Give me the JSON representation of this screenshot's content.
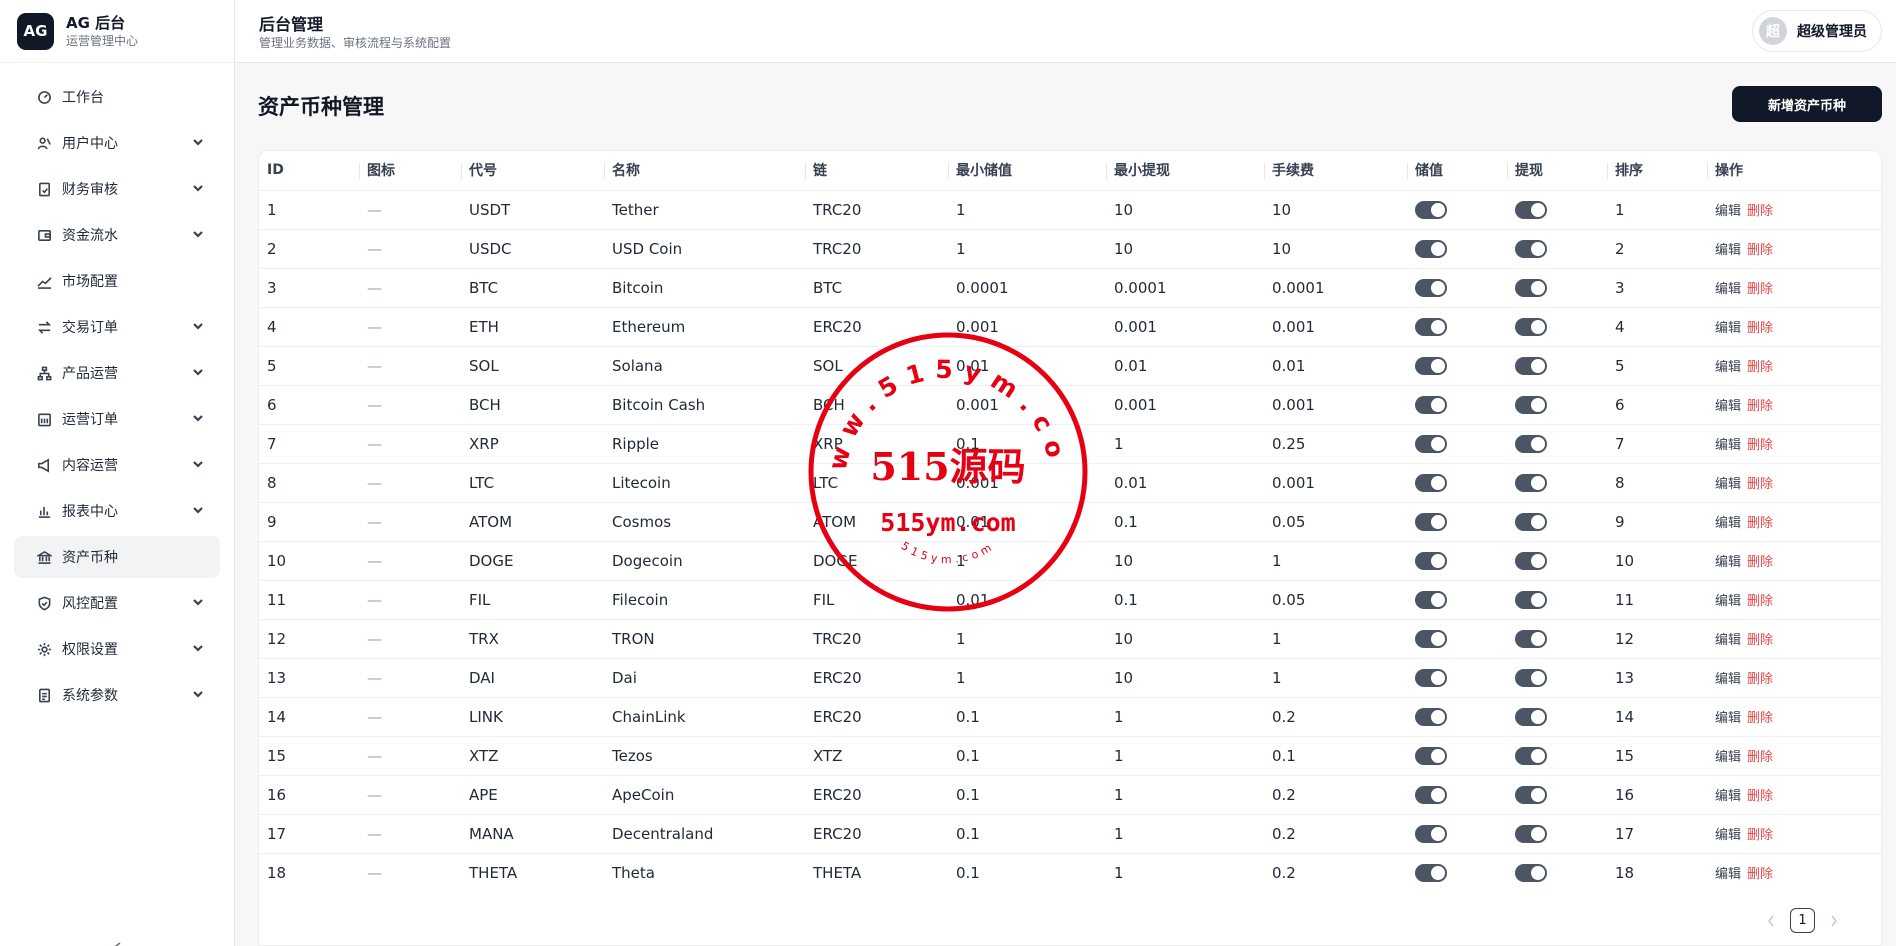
{
  "brand": {
    "logo": "AG",
    "title": "AG 后台",
    "subtitle": "运营管理中心"
  },
  "sidebar": {
    "items": [
      {
        "label": "工作台",
        "icon": "dashboard-icon",
        "expandable": false
      },
      {
        "label": "用户中心",
        "icon": "users-icon",
        "expandable": true
      },
      {
        "label": "财务审核",
        "icon": "file-check-icon",
        "expandable": true
      },
      {
        "label": "资金流水",
        "icon": "wallet-icon",
        "expandable": true
      },
      {
        "label": "市场配置",
        "icon": "trend-icon",
        "expandable": false
      },
      {
        "label": "交易订单",
        "icon": "swap-icon",
        "expandable": true
      },
      {
        "label": "产品运营",
        "icon": "network-icon",
        "expandable": true
      },
      {
        "label": "运营订单",
        "icon": "calendar-icon",
        "expandable": true
      },
      {
        "label": "内容运营",
        "icon": "megaphone-icon",
        "expandable": true
      },
      {
        "label": "报表中心",
        "icon": "bar-chart-icon",
        "expandable": true
      },
      {
        "label": "资产币种",
        "icon": "bank-icon",
        "expandable": false,
        "active": true
      },
      {
        "label": "风控配置",
        "icon": "shield-icon",
        "expandable": true
      },
      {
        "label": "权限设置",
        "icon": "gear-icon",
        "expandable": true
      },
      {
        "label": "系统参数",
        "icon": "document-icon",
        "expandable": true
      }
    ]
  },
  "header": {
    "title": "后台管理",
    "subtitle": "管理业务数据、审核流程与系统配置",
    "avatar": "超",
    "user": "超级管理员"
  },
  "main": {
    "title": "资产币种管理",
    "add_button": "新增资产币种"
  },
  "table": {
    "columns": [
      "ID",
      "图标",
      "代号",
      "名称",
      "链",
      "最小储值",
      "最小提现",
      "手续费",
      "储值",
      "提现",
      "排序",
      "操作"
    ],
    "actions": {
      "edit": "编辑",
      "delete": "删除"
    },
    "empty_icon": "—",
    "rows": [
      {
        "id": "1",
        "code": "USDT",
        "name": "Tether",
        "chain": "TRC20",
        "min_deposit": "1",
        "min_withdraw": "10",
        "fee": "10",
        "deposit_on": true,
        "withdraw_on": true,
        "sort": "1"
      },
      {
        "id": "2",
        "code": "USDC",
        "name": "USD Coin",
        "chain": "TRC20",
        "min_deposit": "1",
        "min_withdraw": "10",
        "fee": "10",
        "deposit_on": true,
        "withdraw_on": true,
        "sort": "2"
      },
      {
        "id": "3",
        "code": "BTC",
        "name": "Bitcoin",
        "chain": "BTC",
        "min_deposit": "0.0001",
        "min_withdraw": "0.0001",
        "fee": "0.0001",
        "deposit_on": true,
        "withdraw_on": true,
        "sort": "3"
      },
      {
        "id": "4",
        "code": "ETH",
        "name": "Ethereum",
        "chain": "ERC20",
        "min_deposit": "0.001",
        "min_withdraw": "0.001",
        "fee": "0.001",
        "deposit_on": true,
        "withdraw_on": true,
        "sort": "4"
      },
      {
        "id": "5",
        "code": "SOL",
        "name": "Solana",
        "chain": "SOL",
        "min_deposit": "0.01",
        "min_withdraw": "0.01",
        "fee": "0.01",
        "deposit_on": true,
        "withdraw_on": true,
        "sort": "5"
      },
      {
        "id": "6",
        "code": "BCH",
        "name": "Bitcoin Cash",
        "chain": "BCH",
        "min_deposit": "0.001",
        "min_withdraw": "0.001",
        "fee": "0.001",
        "deposit_on": true,
        "withdraw_on": true,
        "sort": "6"
      },
      {
        "id": "7",
        "code": "XRP",
        "name": "Ripple",
        "chain": "XRP",
        "min_deposit": "0.1",
        "min_withdraw": "1",
        "fee": "0.25",
        "deposit_on": true,
        "withdraw_on": true,
        "sort": "7"
      },
      {
        "id": "8",
        "code": "LTC",
        "name": "Litecoin",
        "chain": "LTC",
        "min_deposit": "0.001",
        "min_withdraw": "0.01",
        "fee": "0.001",
        "deposit_on": true,
        "withdraw_on": true,
        "sort": "8"
      },
      {
        "id": "9",
        "code": "ATOM",
        "name": "Cosmos",
        "chain": "ATOM",
        "min_deposit": "0.01",
        "min_withdraw": "0.1",
        "fee": "0.05",
        "deposit_on": true,
        "withdraw_on": true,
        "sort": "9"
      },
      {
        "id": "10",
        "code": "DOGE",
        "name": "Dogecoin",
        "chain": "DOGE",
        "min_deposit": "1",
        "min_withdraw": "10",
        "fee": "1",
        "deposit_on": true,
        "withdraw_on": true,
        "sort": "10"
      },
      {
        "id": "11",
        "code": "FIL",
        "name": "Filecoin",
        "chain": "FIL",
        "min_deposit": "0.01",
        "min_withdraw": "0.1",
        "fee": "0.05",
        "deposit_on": true,
        "withdraw_on": true,
        "sort": "11"
      },
      {
        "id": "12",
        "code": "TRX",
        "name": "TRON",
        "chain": "TRC20",
        "min_deposit": "1",
        "min_withdraw": "10",
        "fee": "1",
        "deposit_on": true,
        "withdraw_on": true,
        "sort": "12"
      },
      {
        "id": "13",
        "code": "DAI",
        "name": "Dai",
        "chain": "ERC20",
        "min_deposit": "1",
        "min_withdraw": "10",
        "fee": "1",
        "deposit_on": true,
        "withdraw_on": true,
        "sort": "13"
      },
      {
        "id": "14",
        "code": "LINK",
        "name": "ChainLink",
        "chain": "ERC20",
        "min_deposit": "0.1",
        "min_withdraw": "1",
        "fee": "0.2",
        "deposit_on": true,
        "withdraw_on": true,
        "sort": "14"
      },
      {
        "id": "15",
        "code": "XTZ",
        "name": "Tezos",
        "chain": "XTZ",
        "min_deposit": "0.1",
        "min_withdraw": "1",
        "fee": "0.1",
        "deposit_on": true,
        "withdraw_on": true,
        "sort": "15"
      },
      {
        "id": "16",
        "code": "APE",
        "name": "ApeCoin",
        "chain": "ERC20",
        "min_deposit": "0.1",
        "min_withdraw": "1",
        "fee": "0.2",
        "deposit_on": true,
        "withdraw_on": true,
        "sort": "16"
      },
      {
        "id": "17",
        "code": "MANA",
        "name": "Decentraland",
        "chain": "ERC20",
        "min_deposit": "0.1",
        "min_withdraw": "1",
        "fee": "0.2",
        "deposit_on": true,
        "withdraw_on": true,
        "sort": "17"
      },
      {
        "id": "18",
        "code": "THETA",
        "name": "Theta",
        "chain": "THETA",
        "min_deposit": "0.1",
        "min_withdraw": "1",
        "fee": "0.2",
        "deposit_on": true,
        "withdraw_on": true,
        "sort": "18"
      }
    ]
  },
  "pagination": {
    "current": "1"
  },
  "watermark": {
    "arc_text": "www.515ym.com",
    "center_text": "515源码",
    "domain_text": "515ym.com",
    "bottom_text": "515ym.com",
    "color": "#e60012"
  }
}
